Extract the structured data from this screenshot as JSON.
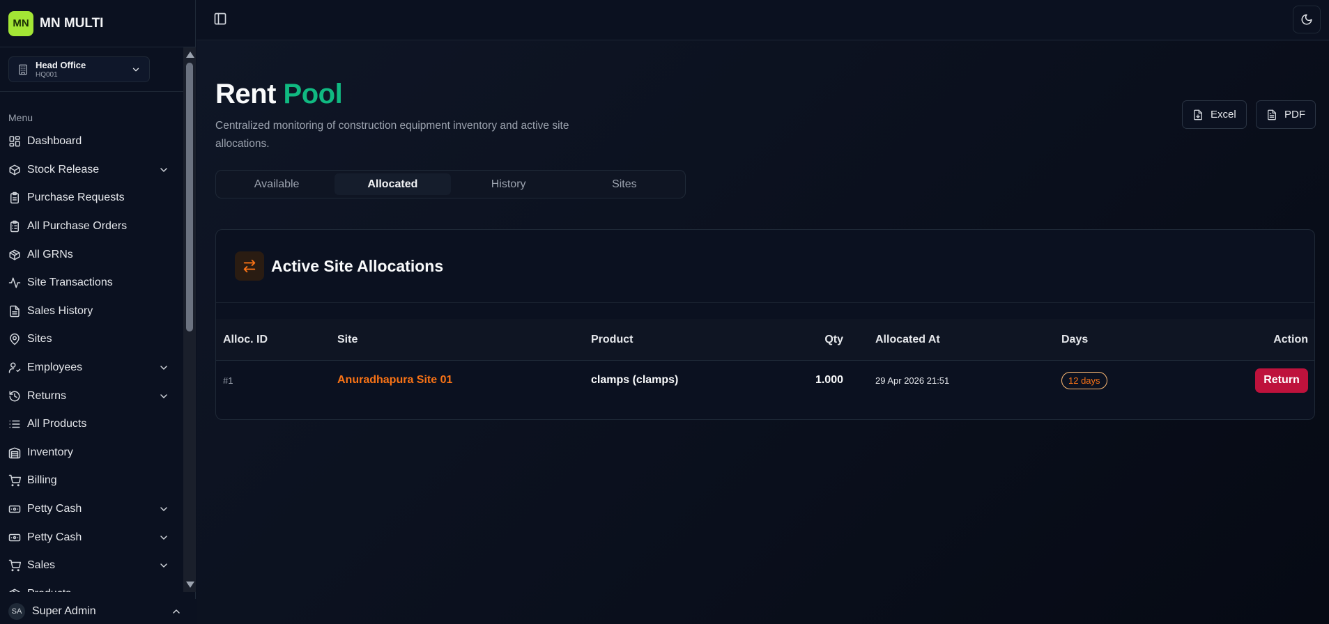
{
  "brand": {
    "logo": "MN",
    "name": "MN MULTI"
  },
  "branch": {
    "name": "Head Office",
    "code": "HQ001"
  },
  "menu_label": "Menu",
  "nav": [
    {
      "label": "Dashboard",
      "icon": "dashboard-icon",
      "expandable": false
    },
    {
      "label": "Stock Release",
      "icon": "boxes-icon",
      "expandable": true
    },
    {
      "label": "Purchase Requests",
      "icon": "clipboard-icon",
      "expandable": false
    },
    {
      "label": "All Purchase Orders",
      "icon": "clipboard-list-icon",
      "expandable": false
    },
    {
      "label": "All GRNs",
      "icon": "package-icon",
      "expandable": false
    },
    {
      "label": "Site Transactions",
      "icon": "activity-icon",
      "expandable": false
    },
    {
      "label": "Sales History",
      "icon": "file-text-icon",
      "expandable": false
    },
    {
      "label": "Sites",
      "icon": "map-pin-icon",
      "expandable": false
    },
    {
      "label": "Employees",
      "icon": "user-check-icon",
      "expandable": true
    },
    {
      "label": "Returns",
      "icon": "history-icon",
      "expandable": true
    },
    {
      "label": "All Products",
      "icon": "list-icon",
      "expandable": false
    },
    {
      "label": "Inventory",
      "icon": "warehouse-icon",
      "expandable": false
    },
    {
      "label": "Billing",
      "icon": "cart-icon",
      "expandable": false
    },
    {
      "label": "Petty Cash",
      "icon": "banknote-icon",
      "expandable": true
    },
    {
      "label": "Petty Cash",
      "icon": "banknote-icon",
      "expandable": true
    },
    {
      "label": "Sales",
      "icon": "cart-icon",
      "expandable": true
    },
    {
      "label": "Products",
      "icon": "package-icon",
      "expandable": true
    }
  ],
  "user": {
    "initials": "SA",
    "name": "Super Admin"
  },
  "page": {
    "title_part1": "Rent",
    "title_part2": "Pool",
    "description": "Centralized monitoring of construction equipment inventory and active site allocations.",
    "excel_label": "Excel",
    "pdf_label": "PDF"
  },
  "tabs": [
    {
      "label": "Available",
      "active": false
    },
    {
      "label": "Allocated",
      "active": true
    },
    {
      "label": "History",
      "active": false
    },
    {
      "label": "Sites",
      "active": false
    }
  ],
  "card": {
    "title": "Active Site Allocations",
    "columns": {
      "id": "Alloc. ID",
      "site": "Site",
      "product": "Product",
      "qty": "Qty",
      "allocated_at": "Allocated At",
      "days": "Days",
      "action": "Action"
    },
    "rows": [
      {
        "id": "#1",
        "site": "Anuradhapura Site 01",
        "product": "clamps (clamps)",
        "qty": "1.000",
        "allocated_at": "29 Apr 2026 21:51",
        "days": "12 days",
        "action": "Return"
      }
    ]
  },
  "colors": {
    "accent_green": "#10b981",
    "accent_orange": "#f97316",
    "danger": "#be123c",
    "logo_bg": "#a3e635"
  }
}
